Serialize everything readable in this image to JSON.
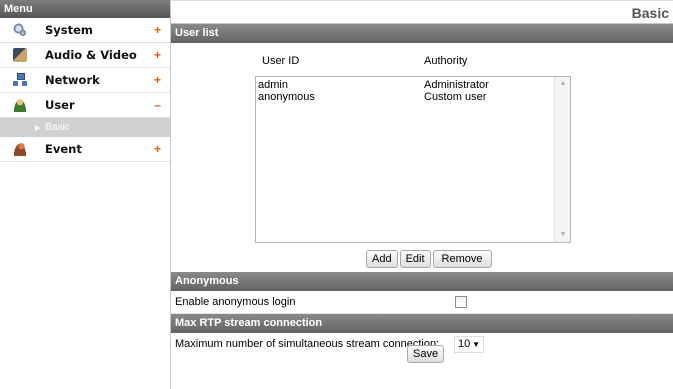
{
  "sidebar": {
    "header": "Menu",
    "items": [
      {
        "label": "System",
        "toggle": "+",
        "icon": "system-icon"
      },
      {
        "label": "Audio & Video",
        "toggle": "+",
        "icon": "audio-video-icon"
      },
      {
        "label": "Network",
        "toggle": "+",
        "icon": "network-icon"
      },
      {
        "label": "User",
        "toggle": "–",
        "icon": "user-icon"
      },
      {
        "label": "Event",
        "toggle": "+",
        "icon": "event-icon"
      }
    ],
    "submenu": {
      "label": "Basic"
    }
  },
  "main": {
    "page_title": "Basic",
    "user_list": {
      "header": "User list",
      "col_user_id": "User ID",
      "col_authority": "Authority",
      "rows": [
        {
          "user_id": "admin",
          "authority": "Administrator"
        },
        {
          "user_id": "anonymous",
          "authority": "Custom user"
        }
      ],
      "buttons": {
        "add": "Add",
        "edit": "Edit",
        "remove": "Remove"
      }
    },
    "anonymous": {
      "header": "Anonymous",
      "enable_label": "Enable anonymous login",
      "enabled": false
    },
    "rtp": {
      "header": "Max RTP stream connection",
      "label": "Maximum number of simultaneous stream connection:",
      "value": "10"
    },
    "save_label": "Save"
  }
}
